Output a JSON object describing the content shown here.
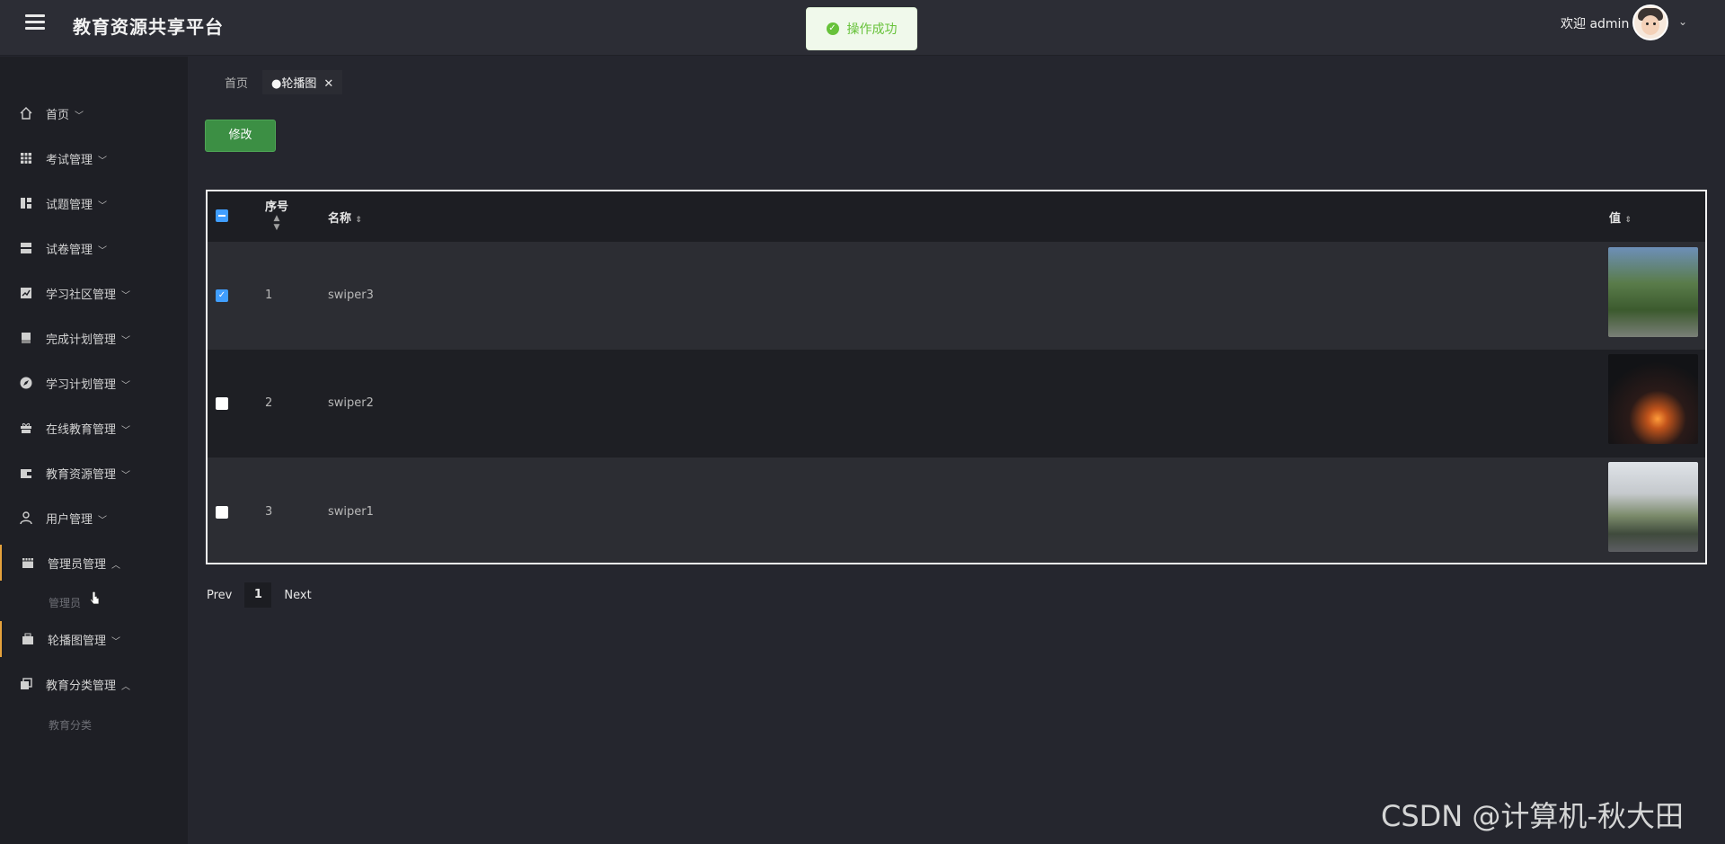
{
  "header": {
    "title": "教育资源共享平台",
    "welcome": "欢迎 admin",
    "toast": "操作成功"
  },
  "sidebar": {
    "items": [
      {
        "label": "首页"
      },
      {
        "label": "考试管理"
      },
      {
        "label": "试题管理"
      },
      {
        "label": "试卷管理"
      },
      {
        "label": "学习社区管理"
      },
      {
        "label": "完成计划管理"
      },
      {
        "label": "学习计划管理"
      },
      {
        "label": "在线教育管理"
      },
      {
        "label": "教育资源管理"
      },
      {
        "label": "用户管理"
      },
      {
        "label": "管理员管理",
        "sub": "管理员"
      },
      {
        "label": "轮播图管理"
      },
      {
        "label": "教育分类管理",
        "sub": "教育分类"
      }
    ]
  },
  "tabs": [
    {
      "label": "首页"
    },
    {
      "label": "●轮播图"
    }
  ],
  "toolbar": {
    "edit_label": "修改"
  },
  "table": {
    "headers": {
      "index": "序号",
      "name": "名称",
      "value": "值"
    },
    "rows": [
      {
        "index": "1",
        "name": "swiper3",
        "checked": true
      },
      {
        "index": "2",
        "name": "swiper2",
        "checked": false
      },
      {
        "index": "3",
        "name": "swiper1",
        "checked": false
      }
    ]
  },
  "pagination": {
    "prev": "Prev",
    "page": "1",
    "next": "Next"
  },
  "watermark": "CSDN @计算机-秋大田"
}
